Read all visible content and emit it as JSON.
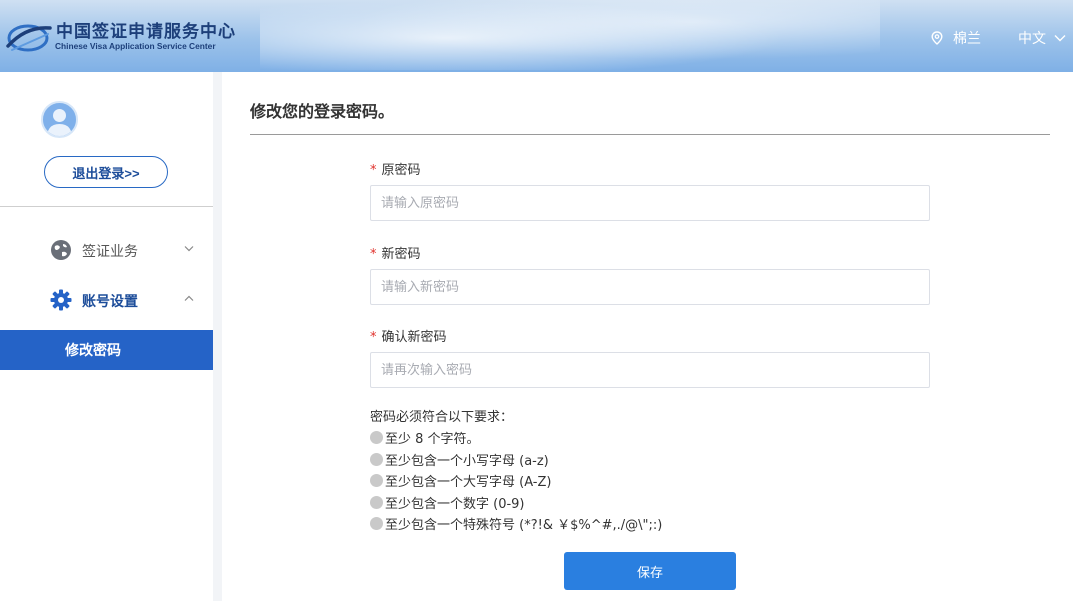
{
  "header": {
    "logo_cn": "中国签证申请服务中心",
    "logo_en": "Chinese Visa Application Service Center",
    "location": "棉兰",
    "language": "中文"
  },
  "sidebar": {
    "logout_label": "退出登录>>",
    "menu": [
      {
        "label": "签证业务",
        "icon": "globe-icon",
        "expanded": false
      },
      {
        "label": "账号设置",
        "icon": "gear-icon",
        "expanded": true
      }
    ],
    "active_sub_label": "修改密码"
  },
  "main": {
    "title": "修改您的登录密码。",
    "fields": [
      {
        "label": "原密码",
        "placeholder": "请输入原密码",
        "value": ""
      },
      {
        "label": "新密码",
        "placeholder": "请输入新密码",
        "value": ""
      },
      {
        "label": "确认新密码",
        "placeholder": "请再次输入密码",
        "value": ""
      }
    ],
    "requirements_title": "密码必须符合以下要求：",
    "requirements": [
      "至少 8 个字符。",
      "至少包含一个小写字母 (a-z)",
      "至少包含一个大写字母 (A-Z)",
      "至少包含一个数字 (0-9)",
      "至少包含一个特殊符号 (*?!& ￥$%^#,./@\\\";:)"
    ],
    "save_label": "保存"
  },
  "colors": {
    "accent": "#2563c7",
    "button": "#2a7fe0",
    "required": "#e0302b",
    "brand_text": "#1d3f7a"
  }
}
